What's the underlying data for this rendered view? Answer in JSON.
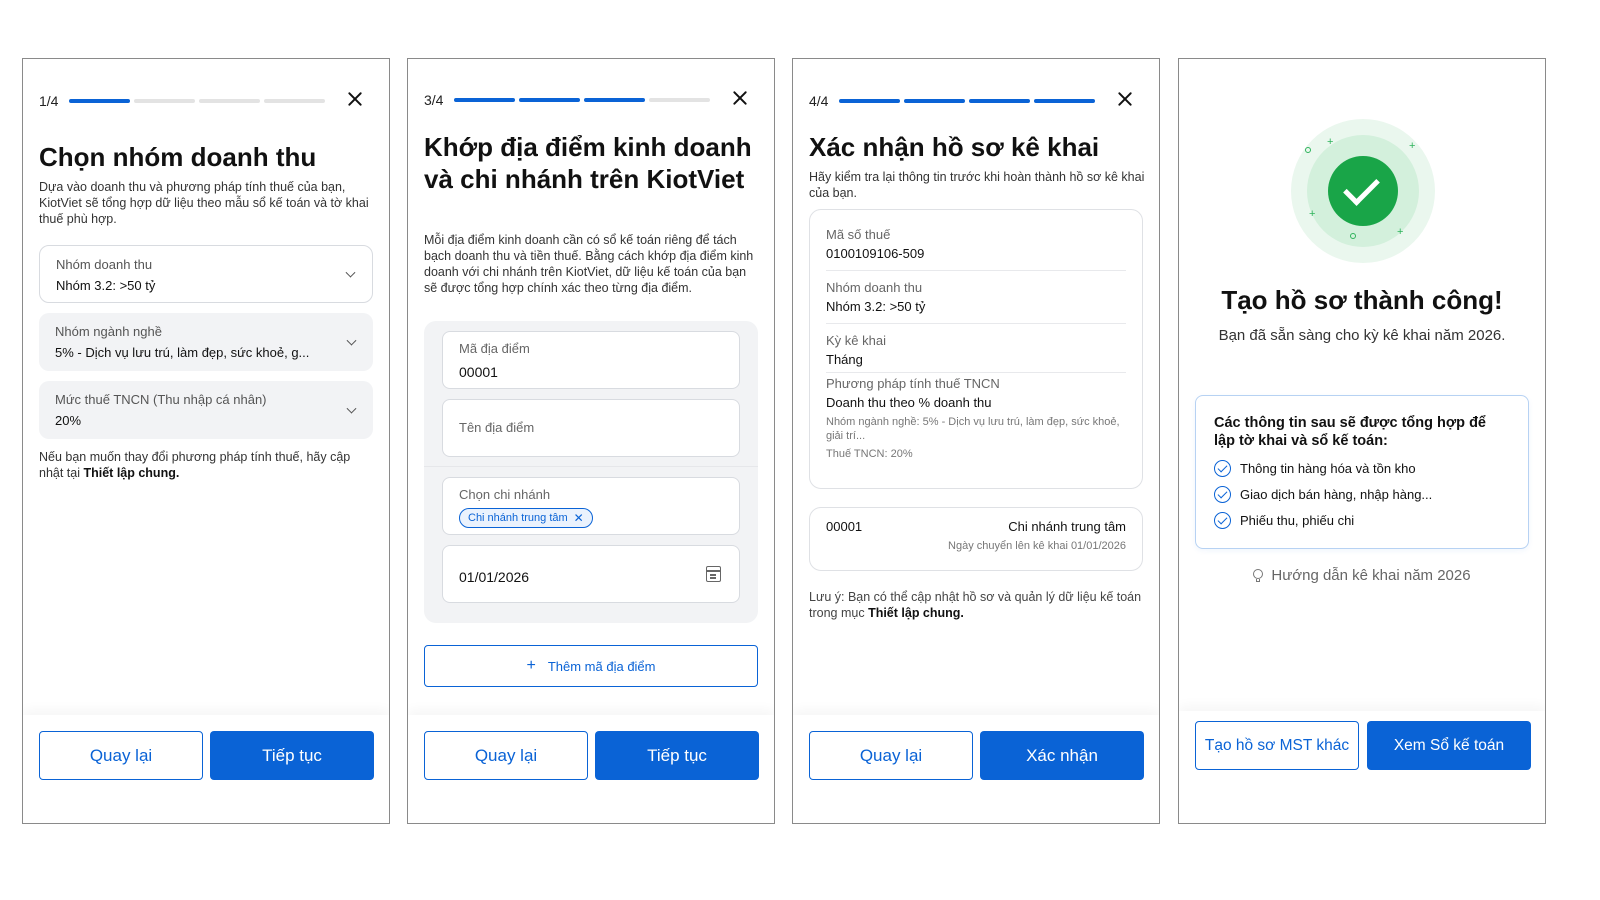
{
  "screen1": {
    "step": "1/4",
    "progress": 0.25,
    "title": "Chọn nhóm doanh thu",
    "description": "Dựa vào doanh thu và phương pháp tính thuế của bạn, KiotViet sẽ tổng hợp dữ liệu theo mẫu sổ kế toán và tờ khai thuế phù hợp.",
    "fields": [
      {
        "label": "Nhóm doanh thu",
        "value": "Nhóm 3.2: >50 tỷ"
      },
      {
        "label": "Nhóm ngành nghề",
        "value": "5% - Dịch vụ lưu trú, làm đẹp, sức khoẻ, g..."
      },
      {
        "label": "Mức thuế TNCN (Thu nhập cá nhân)",
        "value": "20%"
      }
    ],
    "note_prefix": "Nếu bạn muốn thay đổi phương pháp tính thuế, hãy cập nhật tại ",
    "note_link": "Thiết lập chung.",
    "back_label": "Quay lại",
    "next_label": "Tiếp tục"
  },
  "screen2": {
    "step": "3/4",
    "progress": 0.75,
    "title": "Khớp địa điểm kinh doanh và chi nhánh trên KiotViet",
    "description": "Mỗi địa điểm kinh doanh cần có sổ kế toán riêng để tách bạch doanh thu và tiền thuế. Bằng cách khớp địa điểm kinh doanh với chi nhánh trên KiotViet, dữ liệu kế toán của bạn sẽ được tổng hợp chính xác theo từng địa điểm.",
    "location_code_label": "Mã địa điểm",
    "location_code_value": "00001",
    "location_name_placeholder": "Tên địa điểm",
    "branch_label": "Chọn chi nhánh",
    "branch_chip": "Chi nhánh trung tâm",
    "date_value": "01/01/2026",
    "add_label": "Thêm mã địa điểm",
    "back_label": "Quay lại",
    "next_label": "Tiếp tục"
  },
  "screen3": {
    "step": "4/4",
    "progress": 1.0,
    "title": "Xác nhận hồ sơ kê khai",
    "description": "Hãy kiểm tra lại thông tin trước khi hoàn thành hồ sơ kê khai của bạn.",
    "tax_code_label": "Mã số thuế",
    "tax_code_value": "0100109106-509",
    "revenue_group_label": "Nhóm doanh thu",
    "revenue_group_value": "Nhóm 3.2: >50 tỷ",
    "period_label": "Kỳ kê khai",
    "period_value": "Tháng",
    "method_label": "Phương pháp tính thuế TNCN",
    "method_value": "Doanh thu theo % doanh thu",
    "industry_detail": "Nhóm ngành nghề: 5% - Dịch vụ lưu trú, làm đẹp, sức khoẻ, giải trí...",
    "tax_detail": "Thuế TNCN: 20%",
    "location_code": "00001",
    "branch_name": "Chi nhánh trung tâm",
    "transfer_date": "Ngày chuyển lên kê khai 01/01/2026",
    "note_prefix": "Lưu ý: Bạn có thể cập nhật hồ sơ và quản lý dữ liệu kế toán trong mục ",
    "note_link": "Thiết lập chung.",
    "back_label": "Quay lại",
    "confirm_label": "Xác nhận"
  },
  "screen4": {
    "title": "Tạo hồ sơ thành công!",
    "subtitle": "Bạn đã sẵn sàng cho kỳ kê khai năm 2026.",
    "info_heading": "Các thông tin sau sẽ được tổng hợp để lập tờ khai và sổ kế toán:",
    "info_items": [
      "Thông tin hàng hóa và tồn kho",
      "Giao dịch bán hàng, nhập hàng...",
      "Phiếu thu, phiếu chi"
    ],
    "guide_label": "Hướng dẫn kê khai năm 2026",
    "other_profile_label": "Tạo hồ sơ MST khác",
    "view_ledger_label": "Xem Sổ kế toán"
  },
  "colors": {
    "primary": "#0a63d6",
    "success": "#19a548"
  },
  "icons": [
    "close-icon",
    "chevron-down-icon",
    "calendar-icon",
    "plus-icon",
    "checkmark-icon",
    "check-circle-icon",
    "lightbulb-icon"
  ]
}
